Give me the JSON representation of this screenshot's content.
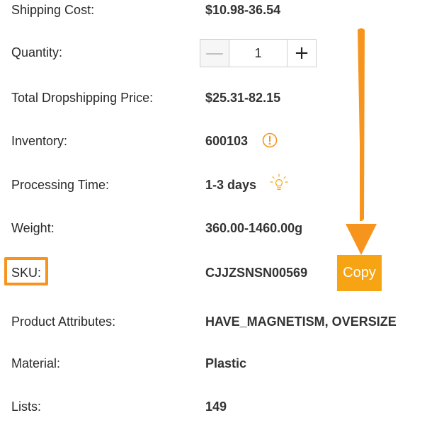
{
  "rows": {
    "shipping_cost": {
      "label": "Shipping Cost:",
      "value": "$10.98-36.54"
    },
    "quantity": {
      "label": "Quantity:",
      "value": "1",
      "minus": "—",
      "plus": "+"
    },
    "total_price": {
      "label": "Total Dropshipping Price:",
      "value": "$25.31-82.15"
    },
    "inventory": {
      "label": "Inventory:",
      "value": "600103",
      "icon": "exclamation-circle-icon"
    },
    "processing_time": {
      "label": "Processing Time:",
      "value": "1-3 days",
      "icon": "lightbulb-icon"
    },
    "weight": {
      "label": "Weight:",
      "value": "360.00-1460.00g"
    },
    "sku": {
      "label": "SKU:",
      "value": "CJJZSNSN00569",
      "copy_label": "Copy"
    },
    "attributes": {
      "label": "Product Attributes:",
      "value": "HAVE_MAGNETISM, OVERSIZE"
    },
    "material": {
      "label": "Material:",
      "value": "Plastic"
    },
    "lists": {
      "label": "Lists:",
      "value": "149"
    }
  },
  "colors": {
    "accent": "#f7941d",
    "copy_button": "#f7a414",
    "arrow": "#f7941d"
  }
}
